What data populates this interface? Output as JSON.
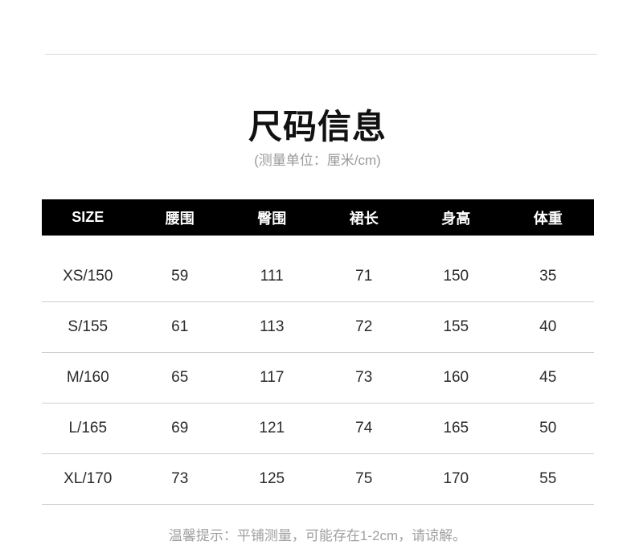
{
  "title": "尺码信息",
  "subtitle": "(测量单位：厘米/cm)",
  "table": {
    "headers": [
      "SIZE",
      "腰围",
      "臀围",
      "裙长",
      "身高",
      "体重"
    ],
    "rows": [
      [
        "XS/150",
        "59",
        "111",
        "71",
        "150",
        "35"
      ],
      [
        "S/155",
        "61",
        "113",
        "72",
        "155",
        "40"
      ],
      [
        "M/160",
        "65",
        "117",
        "73",
        "160",
        "45"
      ],
      [
        "L/165",
        "69",
        "121",
        "74",
        "165",
        "50"
      ],
      [
        "XL/170",
        "73",
        "125",
        "75",
        "170",
        "55"
      ]
    ]
  },
  "footnote": "温馨提示：平铺测量，可能存在1-2cm，请谅解。"
}
